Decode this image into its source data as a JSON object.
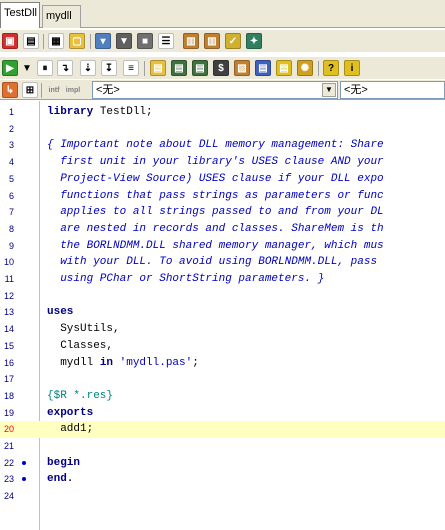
{
  "tabs": [
    {
      "label": "TestDll",
      "active": true
    },
    {
      "label": "mydll",
      "active": false
    }
  ],
  "toolbar3": {
    "combo_left": "<无>",
    "combo_right": "<无>"
  },
  "editor": {
    "lines": [
      {
        "num": "1",
        "parts": [
          {
            "t": "library",
            "c": "kw"
          },
          {
            "t": " TestDll;",
            "c": ""
          }
        ]
      },
      {
        "num": "2",
        "parts": []
      },
      {
        "num": "3",
        "parts": [
          {
            "t": "{ Important note about DLL memory management: Share",
            "c": "cm"
          }
        ]
      },
      {
        "num": "4",
        "parts": [
          {
            "t": "  first unit in your library's USES clause AND your",
            "c": "cm"
          }
        ]
      },
      {
        "num": "5",
        "parts": [
          {
            "t": "  Project-View Source) USES clause if your DLL expo",
            "c": "cm"
          }
        ]
      },
      {
        "num": "6",
        "parts": [
          {
            "t": "  functions that pass strings as parameters or func",
            "c": "cm"
          }
        ]
      },
      {
        "num": "7",
        "parts": [
          {
            "t": "  applies to all strings passed to and from your DL",
            "c": "cm"
          }
        ]
      },
      {
        "num": "8",
        "parts": [
          {
            "t": "  are nested in records and classes. ShareMem is th",
            "c": "cm"
          }
        ]
      },
      {
        "num": "9",
        "parts": [
          {
            "t": "  the BORLNDMM.DLL shared memory manager, which mus",
            "c": "cm"
          }
        ]
      },
      {
        "num": "10",
        "parts": [
          {
            "t": "  with your DLL. To avoid using BORLNDMM.DLL, pass",
            "c": "cm"
          }
        ]
      },
      {
        "num": "11",
        "parts": [
          {
            "t": "  using PChar or ShortString parameters. }",
            "c": "cm"
          }
        ]
      },
      {
        "num": "12",
        "parts": []
      },
      {
        "num": "13",
        "parts": [
          {
            "t": "uses",
            "c": "kw"
          }
        ]
      },
      {
        "num": "14",
        "parts": [
          {
            "t": "  SysUtils,",
            "c": ""
          }
        ]
      },
      {
        "num": "15",
        "parts": [
          {
            "t": "  Classes,",
            "c": ""
          }
        ]
      },
      {
        "num": "16",
        "parts": [
          {
            "t": "  mydll ",
            "c": ""
          },
          {
            "t": "in",
            "c": "kw"
          },
          {
            "t": " ",
            "c": ""
          },
          {
            "t": "'mydll.pas'",
            "c": "str"
          },
          {
            "t": ";",
            "c": ""
          }
        ]
      },
      {
        "num": "17",
        "parts": []
      },
      {
        "num": "18",
        "parts": [
          {
            "t": "{$R *.res}",
            "c": "dir"
          }
        ]
      },
      {
        "num": "19",
        "parts": [
          {
            "t": "exports",
            "c": "kw"
          }
        ]
      },
      {
        "num": "20",
        "parts": [
          {
            "t": "  add1;",
            "c": ""
          }
        ],
        "red": true,
        "highlight": true
      },
      {
        "num": "21",
        "parts": []
      },
      {
        "num": "22",
        "parts": [
          {
            "t": "begin",
            "c": "kw"
          }
        ],
        "dot": true
      },
      {
        "num": "23",
        "parts": [
          {
            "t": "end.",
            "c": "kw"
          }
        ],
        "dot": true
      },
      {
        "num": "24",
        "parts": []
      }
    ]
  }
}
